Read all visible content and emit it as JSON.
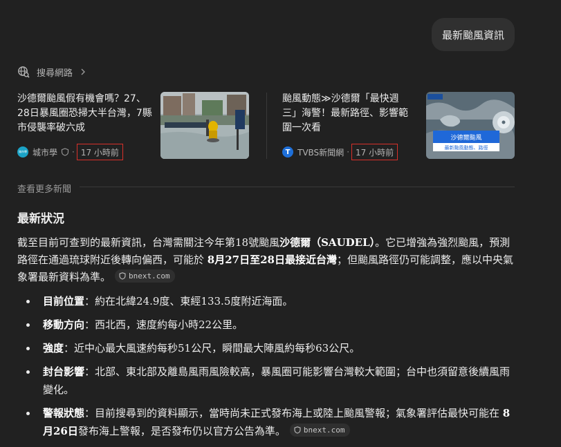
{
  "user_message": "最新颱風資訊",
  "search": {
    "label": "搜尋網路"
  },
  "news": [
    {
      "title_lines": [
        "沙德爾颱風假有機會嗎？27、",
        "28日暴風圈恐掃大半台灣，7縣",
        "市侵襲率破六成"
      ],
      "source": "城市學",
      "logo_text": "城市學",
      "time": "17 小時前"
    },
    {
      "title_lines": [
        "颱風動態≫沙德爾「最快週",
        "三」海警！最新路徑、影響範",
        "圍一次看"
      ],
      "source": "TVBS新聞網",
      "logo_text": "T",
      "time": "17 小時前",
      "thumb_caption_1": "沙德爾颱風",
      "thumb_caption_2": "最新颱風動態、路徑"
    }
  ],
  "more_news": "查看更多新聞",
  "section_title": "最新狀況",
  "paragraph": {
    "p1": "截至目前可查到的最新資訊，台灣需關注今年第18號颱風",
    "b1": "沙德爾（SAUDEL）",
    "p2": "。它已增強為強烈颱風，預測路徑在通過琉球附近後轉向偏西，可能於 ",
    "b2": "8月27日至28日最接近台灣",
    "p3": "；但颱風路徑仍可能調整，應以中央氣象署最新資料為準。",
    "cite": "bnext.com"
  },
  "facts": [
    {
      "label": "目前位置",
      "text": "：約在北緯24.9度、東經133.5度附近海面。"
    },
    {
      "label": "移動方向",
      "text": "：西北西，速度約每小時22公里。"
    },
    {
      "label": "強度",
      "text": "：近中心最大風速約每秒51公尺，瞬間最大陣風約每秒63公尺。"
    },
    {
      "label": "封台影響",
      "text": "：北部、東北部及離島風雨風險較高，暴風圈可能影響台灣較大範圍；台中也須留意後續風雨變化。"
    },
    {
      "label": "警報狀態",
      "text": "：目前搜尋到的資料顯示，當時尚未正式發布海上或陸上颱風警報；氣象署評估最快可能在 ",
      "bold2": "8月26日",
      "text2": "發布海上警報，是否發布仍以官方公告為準。",
      "cite": "bnext.com"
    }
  ],
  "colors": {
    "background": "#212121",
    "bubble": "#303030",
    "highlight_box": "#d9302a"
  }
}
